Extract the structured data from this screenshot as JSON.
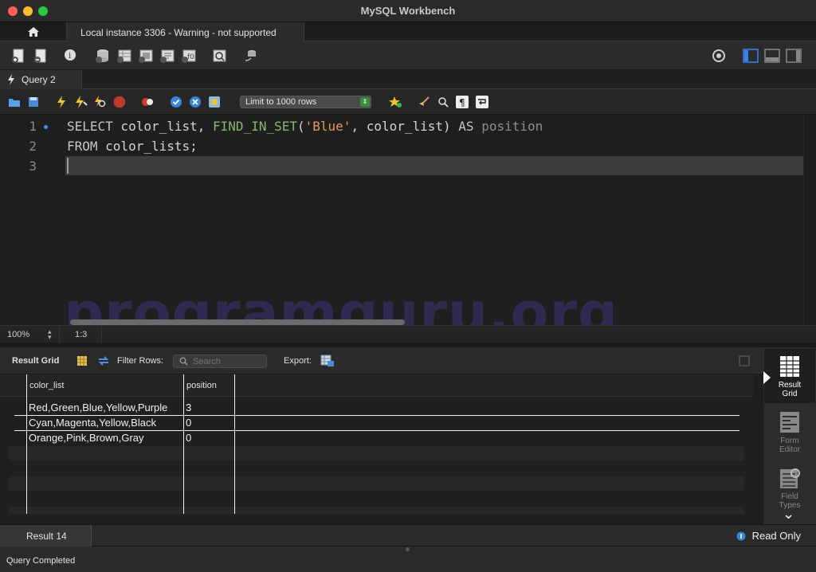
{
  "window": {
    "title": "MySQL Workbench"
  },
  "connection": {
    "tab_label": "Local instance 3306 - Warning - not supported"
  },
  "query_tab": {
    "label": "Query 2"
  },
  "sql_toolbar": {
    "limit_label": "Limit to 1000 rows"
  },
  "editor": {
    "lines": [
      {
        "num": "1",
        "tokens": [
          {
            "t": "SELECT",
            "c": "kw"
          },
          {
            "t": " color_list, ",
            "c": ""
          },
          {
            "t": "FIND_IN_SET",
            "c": "fn"
          },
          {
            "t": "(",
            "c": ""
          },
          {
            "t": "'Blue'",
            "c": "str"
          },
          {
            "t": ", color_list) ",
            "c": ""
          },
          {
            "t": "AS",
            "c": "kw"
          },
          {
            "t": " ",
            "c": ""
          },
          {
            "t": "position",
            "c": "alias"
          }
        ]
      },
      {
        "num": "2",
        "tokens": [
          {
            "t": "FROM",
            "c": "kw"
          },
          {
            "t": " color_lists;",
            "c": ""
          }
        ]
      },
      {
        "num": "3",
        "tokens": []
      }
    ],
    "zoom": "100%",
    "cursor_position": "1:3",
    "watermark": "programguru.org"
  },
  "result_toolbar": {
    "result_grid_label": "Result Grid",
    "filter_rows_label": "Filter Rows:",
    "search_placeholder": "Search",
    "export_label": "Export:"
  },
  "grid": {
    "columns": [
      "color_list",
      "position"
    ],
    "rows": [
      [
        "Red,Green,Blue,Yellow,Purple",
        "3"
      ],
      [
        "Cyan,Magenta,Yellow,Black",
        "0"
      ],
      [
        "Orange,Pink,Brown,Gray",
        "0"
      ]
    ]
  },
  "side_panel": {
    "items": [
      {
        "label": "Result\nGrid",
        "active": true
      },
      {
        "label": "Form\nEditor",
        "active": false
      },
      {
        "label": "Field\nTypes",
        "active": false
      }
    ]
  },
  "result_tab": {
    "label": "Result 14"
  },
  "read_only": {
    "label": "Read Only"
  },
  "status": {
    "text": "Query Completed"
  }
}
